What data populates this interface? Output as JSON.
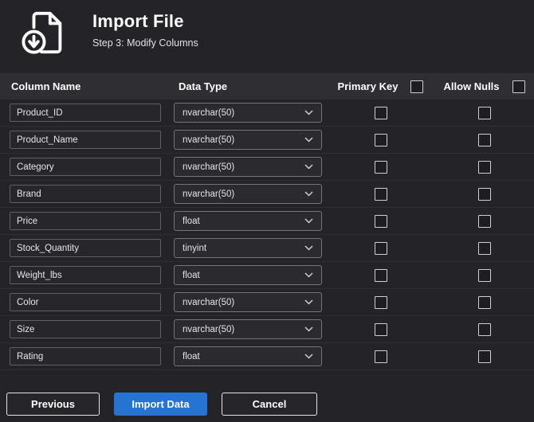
{
  "header": {
    "title": "Import File",
    "subtitle": "Step 3: Modify Columns"
  },
  "table": {
    "headers": {
      "column_name": "Column Name",
      "data_type": "Data Type",
      "primary_key": "Primary Key",
      "allow_nulls": "Allow Nulls"
    },
    "header_checkboxes": {
      "primary_key_all_checked": false,
      "allow_nulls_all_checked": false
    },
    "rows": [
      {
        "name": "Product_ID",
        "type": "nvarchar(50)",
        "primary_key": false,
        "allow_nulls": false
      },
      {
        "name": "Product_Name",
        "type": "nvarchar(50)",
        "primary_key": false,
        "allow_nulls": false
      },
      {
        "name": "Category",
        "type": "nvarchar(50)",
        "primary_key": false,
        "allow_nulls": false
      },
      {
        "name": "Brand",
        "type": "nvarchar(50)",
        "primary_key": false,
        "allow_nulls": false
      },
      {
        "name": "Price",
        "type": "float",
        "primary_key": false,
        "allow_nulls": false
      },
      {
        "name": "Stock_Quantity",
        "type": "tinyint",
        "primary_key": false,
        "allow_nulls": false
      },
      {
        "name": "Weight_lbs",
        "type": "float",
        "primary_key": false,
        "allow_nulls": false
      },
      {
        "name": "Color",
        "type": "nvarchar(50)",
        "primary_key": false,
        "allow_nulls": false
      },
      {
        "name": "Size",
        "type": "nvarchar(50)",
        "primary_key": false,
        "allow_nulls": false
      },
      {
        "name": "Rating",
        "type": "float",
        "primary_key": false,
        "allow_nulls": false
      }
    ]
  },
  "footer": {
    "previous_label": "Previous",
    "import_label": "Import Data",
    "cancel_label": "Cancel"
  },
  "colors": {
    "accent_blue": "#2673d2",
    "background": "#242428",
    "table_header_bg": "#2e2e33"
  }
}
